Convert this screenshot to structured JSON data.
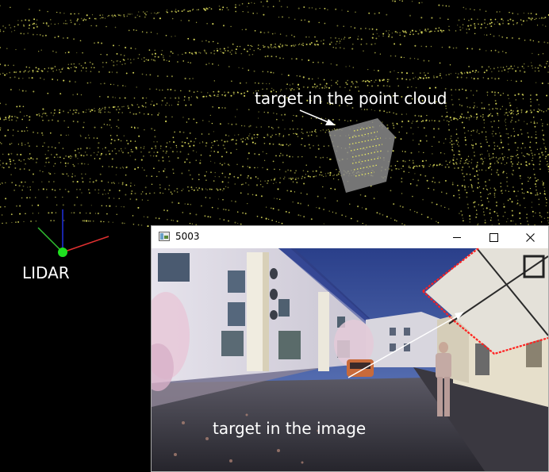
{
  "annotations": {
    "point_cloud_label": "target in the point cloud",
    "lidar_label": "LIDAR",
    "image_label": "target in the image"
  },
  "window": {
    "title": "5003",
    "icon": "app-window-icon",
    "buttons": {
      "minimize_icon": "minimize-icon",
      "maximize_icon": "maximize-icon",
      "close_icon": "close-icon"
    }
  },
  "colors": {
    "background": "#000000",
    "lidar_points": "#f0f060",
    "target_plane": "#8a8a8a",
    "axis_x": "#e03030",
    "axis_y": "#30c030",
    "axis_z": "#2030e0",
    "origin": "#20e020",
    "projected_outline": "#ff2020",
    "annotation_text": "#ffffff"
  }
}
